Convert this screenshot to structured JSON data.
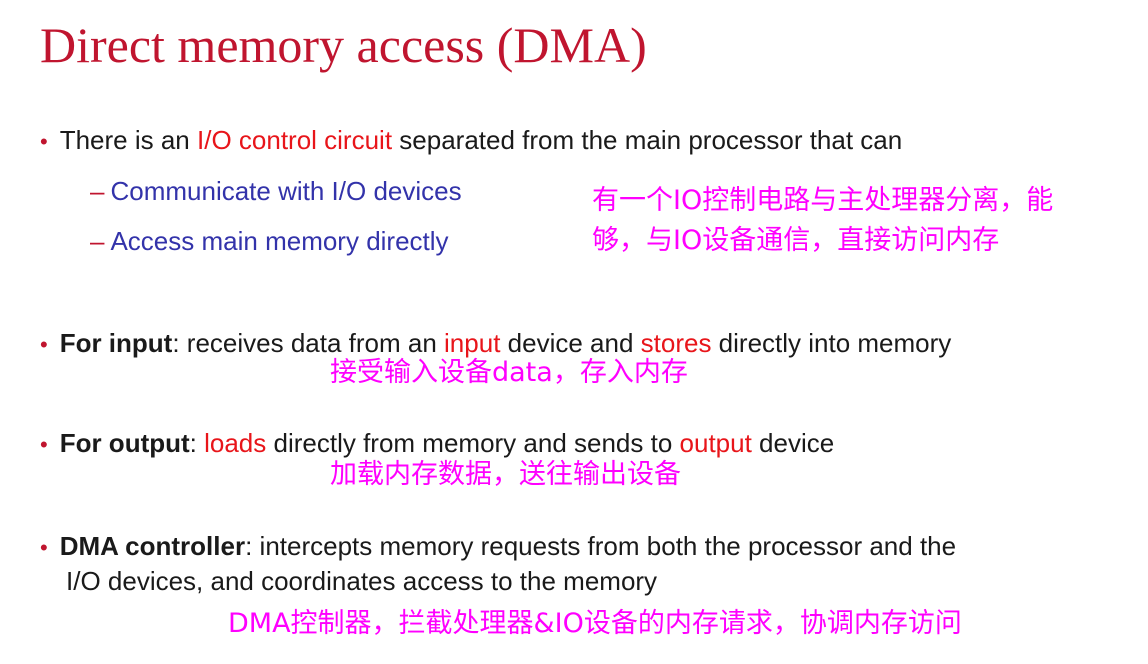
{
  "title": "Direct memory access (DMA)",
  "bullet_symbol": "•",
  "bullets": [
    {
      "parts": [
        "There is an ",
        "I/O control circuit",
        " separated from the main processor that can"
      ],
      "subitems": [
        {
          "dash": "–",
          "text": "Communicate with I/O devices"
        },
        {
          "dash": "–",
          "text": "Access main memory directly"
        }
      ]
    },
    {
      "parts": [
        "For input",
        ": receives  data from an ",
        "input",
        " device and ",
        "stores",
        " directly into memory"
      ]
    },
    {
      "parts": [
        "For output",
        ": ",
        "loads",
        " directly from memory and sends to ",
        "output",
        " device"
      ]
    },
    {
      "line1": [
        "DMA controller",
        ": intercepts memory requests from both the processor and the"
      ],
      "line2": "I/O devices, and coordinates access to the memory"
    }
  ],
  "annotations": {
    "note1_line1": "有一个IO控制电路与主处理器分离，能",
    "note1_line2": "够，与IO设备通信，直接访问内存",
    "note2": "接受输入设备data，存入内存",
    "note3": "加载内存数据，送往输出设备",
    "note4": "DMA控制器，拦截处理器&IO设备的内存请求，协调内存访问"
  },
  "colors": {
    "title": "#c0152f",
    "highlight": "#e8151a",
    "sub_item": "#3333aa",
    "annotation": "#ff00ff"
  }
}
